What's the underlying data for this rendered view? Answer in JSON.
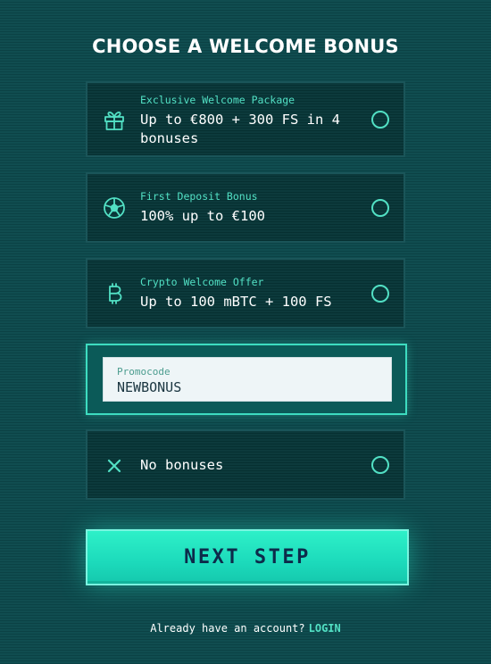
{
  "title": "CHOOSE A WELCOME BONUS",
  "bonuses": [
    {
      "icon": "gift-icon",
      "subtitle": "Exclusive Welcome Package",
      "main": "Up to €800 + 300 FS in 4 bonuses",
      "selected": false
    },
    {
      "icon": "soccer-ball-icon",
      "subtitle": "First Deposit Bonus",
      "main": "100% up to €100",
      "selected": false
    },
    {
      "icon": "bitcoin-icon",
      "subtitle": "Crypto Welcome Offer",
      "main": "Up to 100 mBTC + 100 FS",
      "selected": false
    }
  ],
  "promo": {
    "label": "Promocode",
    "value": "NEWBONUS"
  },
  "no_bonus": {
    "icon": "close-icon",
    "label": "No bonuses",
    "selected": false
  },
  "next_button": "NEXT STEP",
  "footer": {
    "text": "Already have an account?",
    "link": "LOGIN"
  },
  "colors": {
    "background": "#0c4a4d",
    "accent": "#52e0c4",
    "button": "#1cdabb",
    "button_text": "#0d2a4a"
  }
}
